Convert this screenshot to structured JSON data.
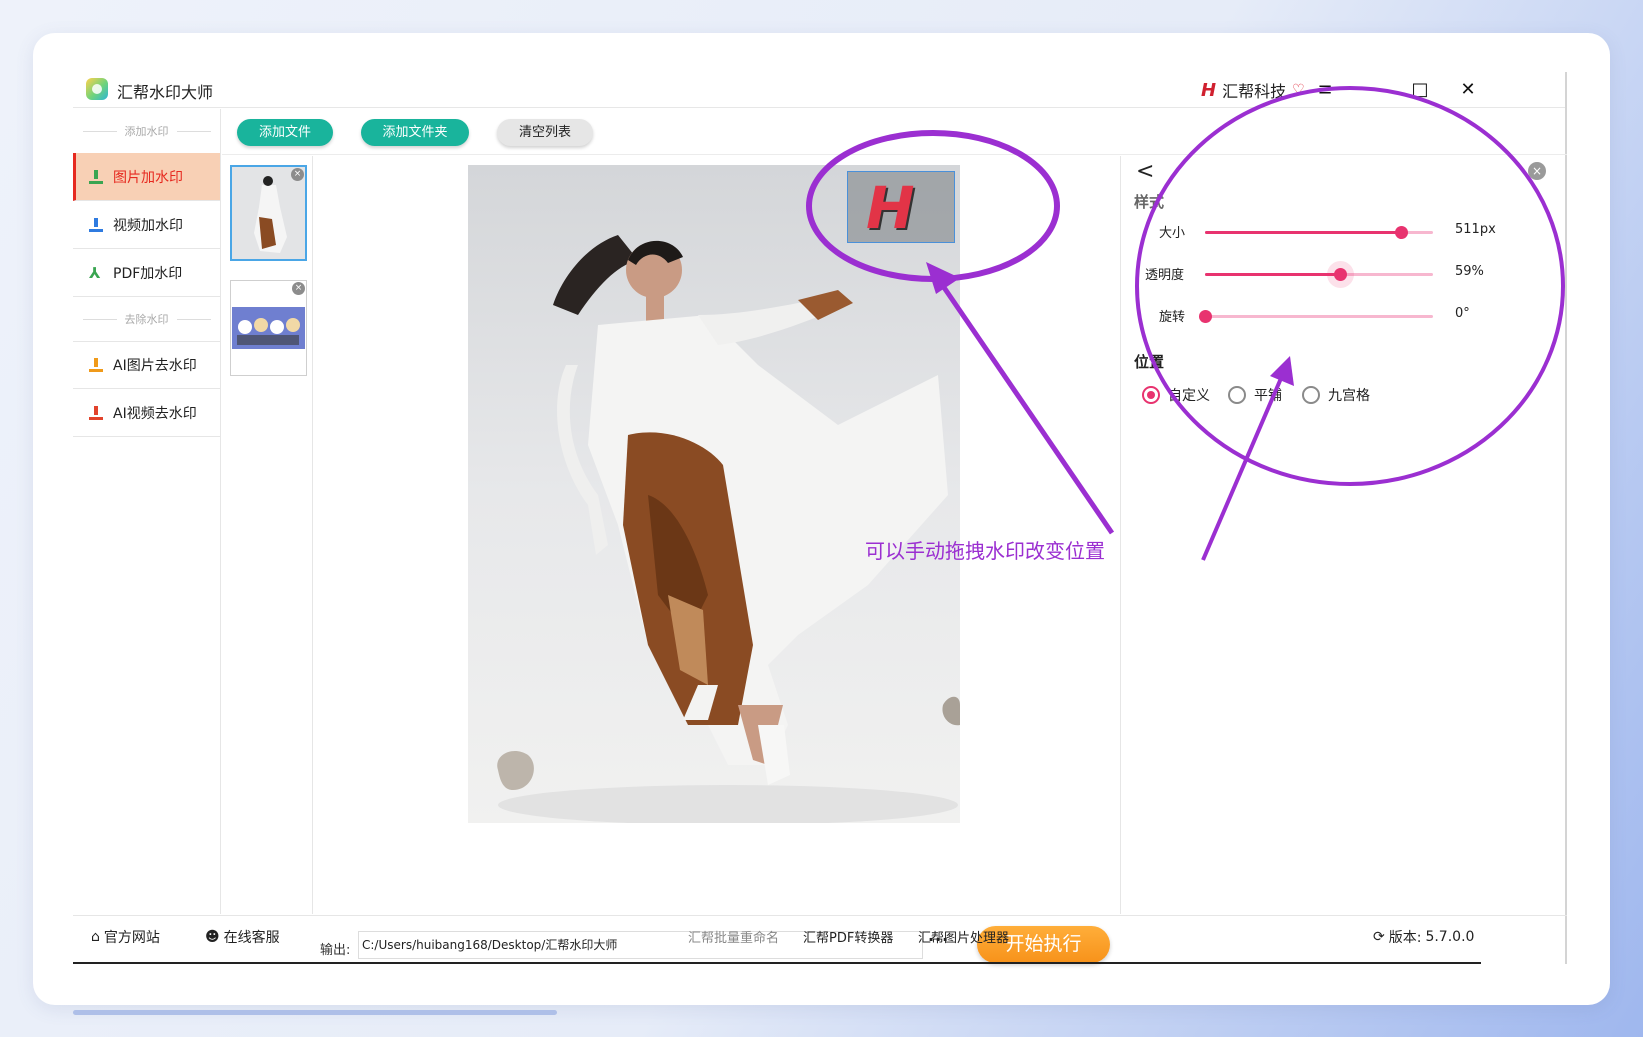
{
  "app": {
    "title": "汇帮水印大师",
    "brand": "汇帮科技"
  },
  "window_controls": {
    "menu": "≡",
    "minimize": "—",
    "maximize": "□",
    "close": "✕"
  },
  "sidebar": {
    "add_section": "添加水印",
    "remove_section": "去除水印",
    "items": [
      {
        "label": "图片加水印",
        "icon": "upload-icon"
      },
      {
        "label": "视频加水印",
        "icon": "upload-icon"
      },
      {
        "label": "PDF加水印",
        "icon": "pdf-icon"
      },
      {
        "label": "AI图片去水印",
        "icon": "upload-icon"
      },
      {
        "label": "AI视频去水印",
        "icon": "upload-icon"
      }
    ]
  },
  "toolbar": {
    "add_file": "添加文件",
    "add_folder": "添加文件夹",
    "clear_list": "清空列表"
  },
  "output": {
    "label": "输出:",
    "path": "C:/Users/huibang168/Desktop/汇帮水印大师",
    "more": "···",
    "start": "开始执行"
  },
  "panel": {
    "style_title": "样式",
    "size": {
      "label": "大小",
      "value": "511px",
      "fraction": 0.86
    },
    "opacity": {
      "label": "透明度",
      "value": "59%",
      "fraction": 0.59
    },
    "rotation": {
      "label": "旋转",
      "value": "0°",
      "fraction": 0.0
    },
    "position_title": "位置",
    "position_options": [
      "自定义",
      "平铺",
      "九宫格"
    ],
    "position_selected": "自定义"
  },
  "annotation": "可以手动拖拽水印改变位置",
  "statusbar": {
    "website": "官方网站",
    "support": "在线客服",
    "link1": "汇帮批量重命名",
    "link2": "汇帮PDF转换器",
    "link3": "汇帮图片处理器",
    "version_label": "版本:",
    "version": "5.7.0.0"
  },
  "colors": {
    "accent": "#e8336f",
    "teal": "#19b49c",
    "orange": "#f7921a",
    "annotation": "#9b2fd1",
    "active_bg": "#f8d0b5"
  }
}
